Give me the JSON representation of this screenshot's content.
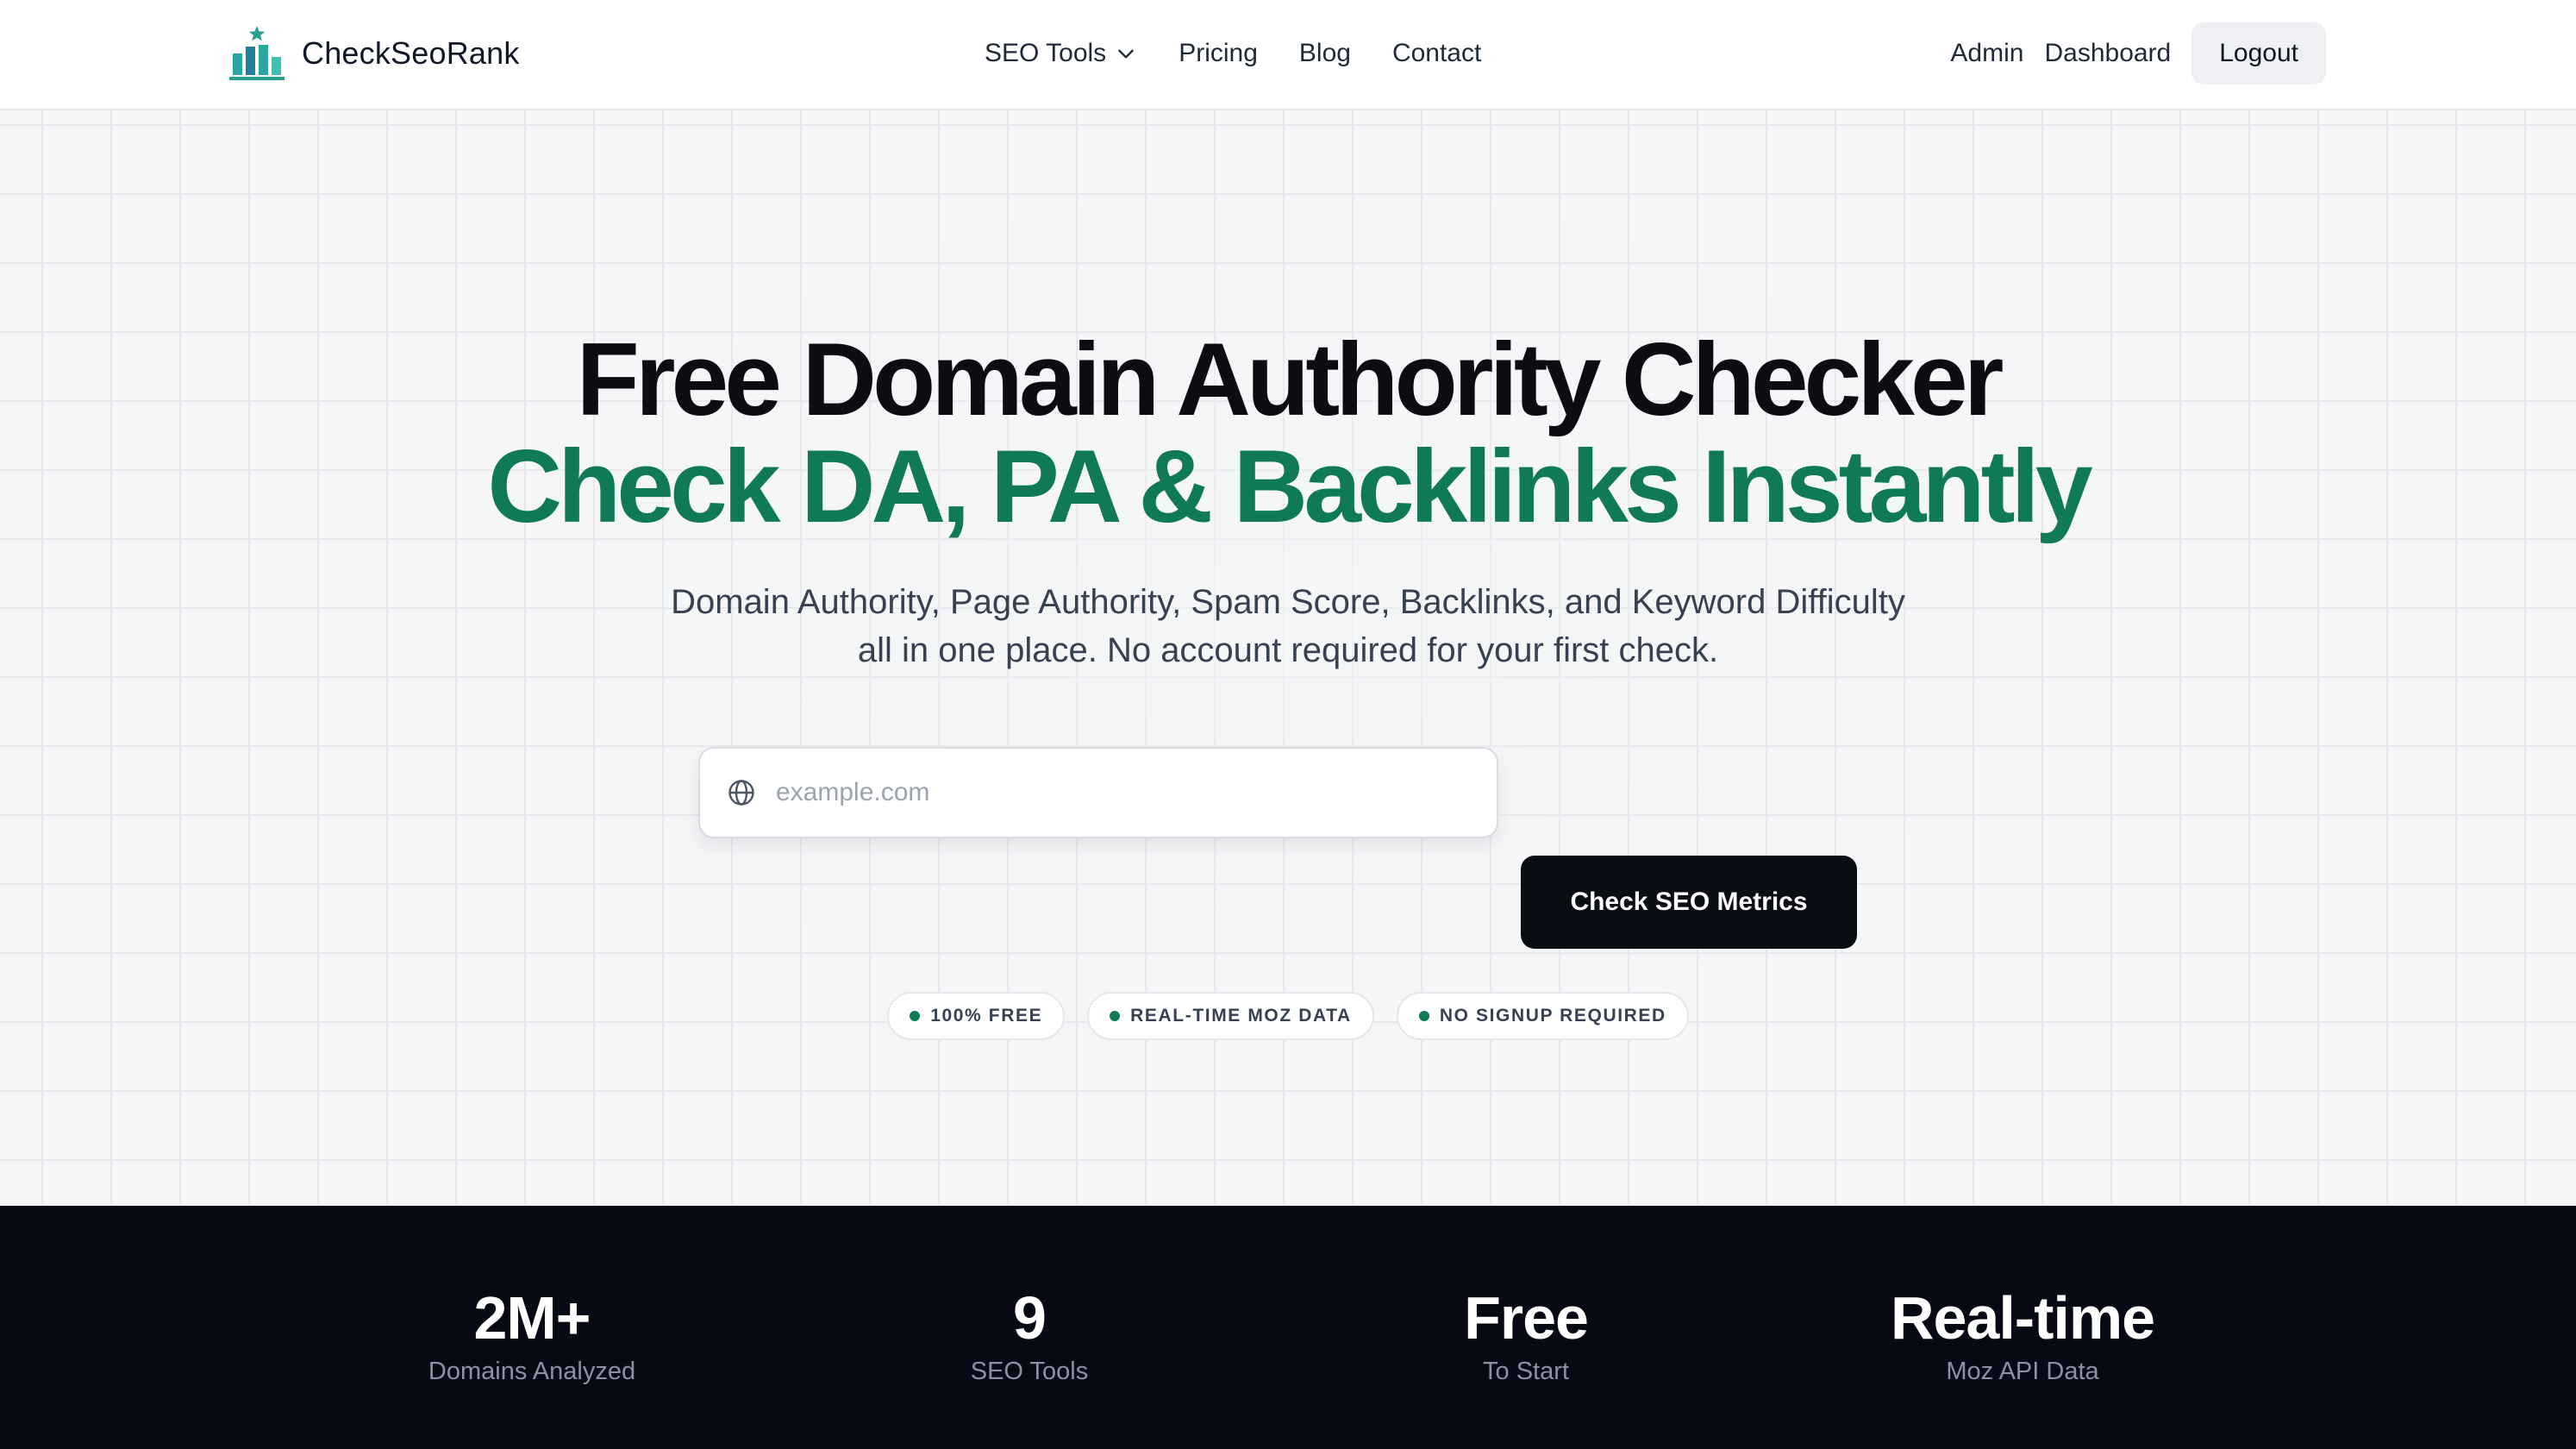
{
  "header": {
    "brand": "CheckSeoRank",
    "nav": [
      {
        "label": "SEO Tools",
        "has_dropdown": true
      },
      {
        "label": "Pricing"
      },
      {
        "label": "Blog"
      },
      {
        "label": "Contact"
      }
    ],
    "right": {
      "admin": "Admin",
      "dashboard": "Dashboard",
      "logout": "Logout"
    }
  },
  "hero": {
    "title_line1": "Free Domain Authority Checker",
    "title_line2": "Check DA, PA & Backlinks Instantly",
    "subtitle_line1": "Domain Authority, Page Authority, Spam Score, Backlinks, and Keyword Difficulty",
    "subtitle_line2": "all in one place. No account required for your first check.",
    "search_placeholder": "example.com",
    "search_value": "",
    "cta": "Check SEO Metrics",
    "badges": [
      "100% FREE",
      "REAL-TIME MOZ DATA",
      "NO SIGNUP REQUIRED"
    ]
  },
  "stats": [
    {
      "value": "2M+",
      "label": "Domains Analyzed"
    },
    {
      "value": "9",
      "label": "SEO Tools"
    },
    {
      "value": "Free",
      "label": "To Start"
    },
    {
      "value": "Real-time",
      "label": "Moz API Data"
    }
  ],
  "colors": {
    "accent_green": "#0f7a55",
    "dark": "#0b0d14",
    "logo_teal": "#2a9d8f"
  },
  "icons": {
    "logo": "bar-chart-star-icon",
    "dropdown": "chevron-down-icon",
    "search": "globe-icon",
    "badge": "green-dot-icon"
  }
}
